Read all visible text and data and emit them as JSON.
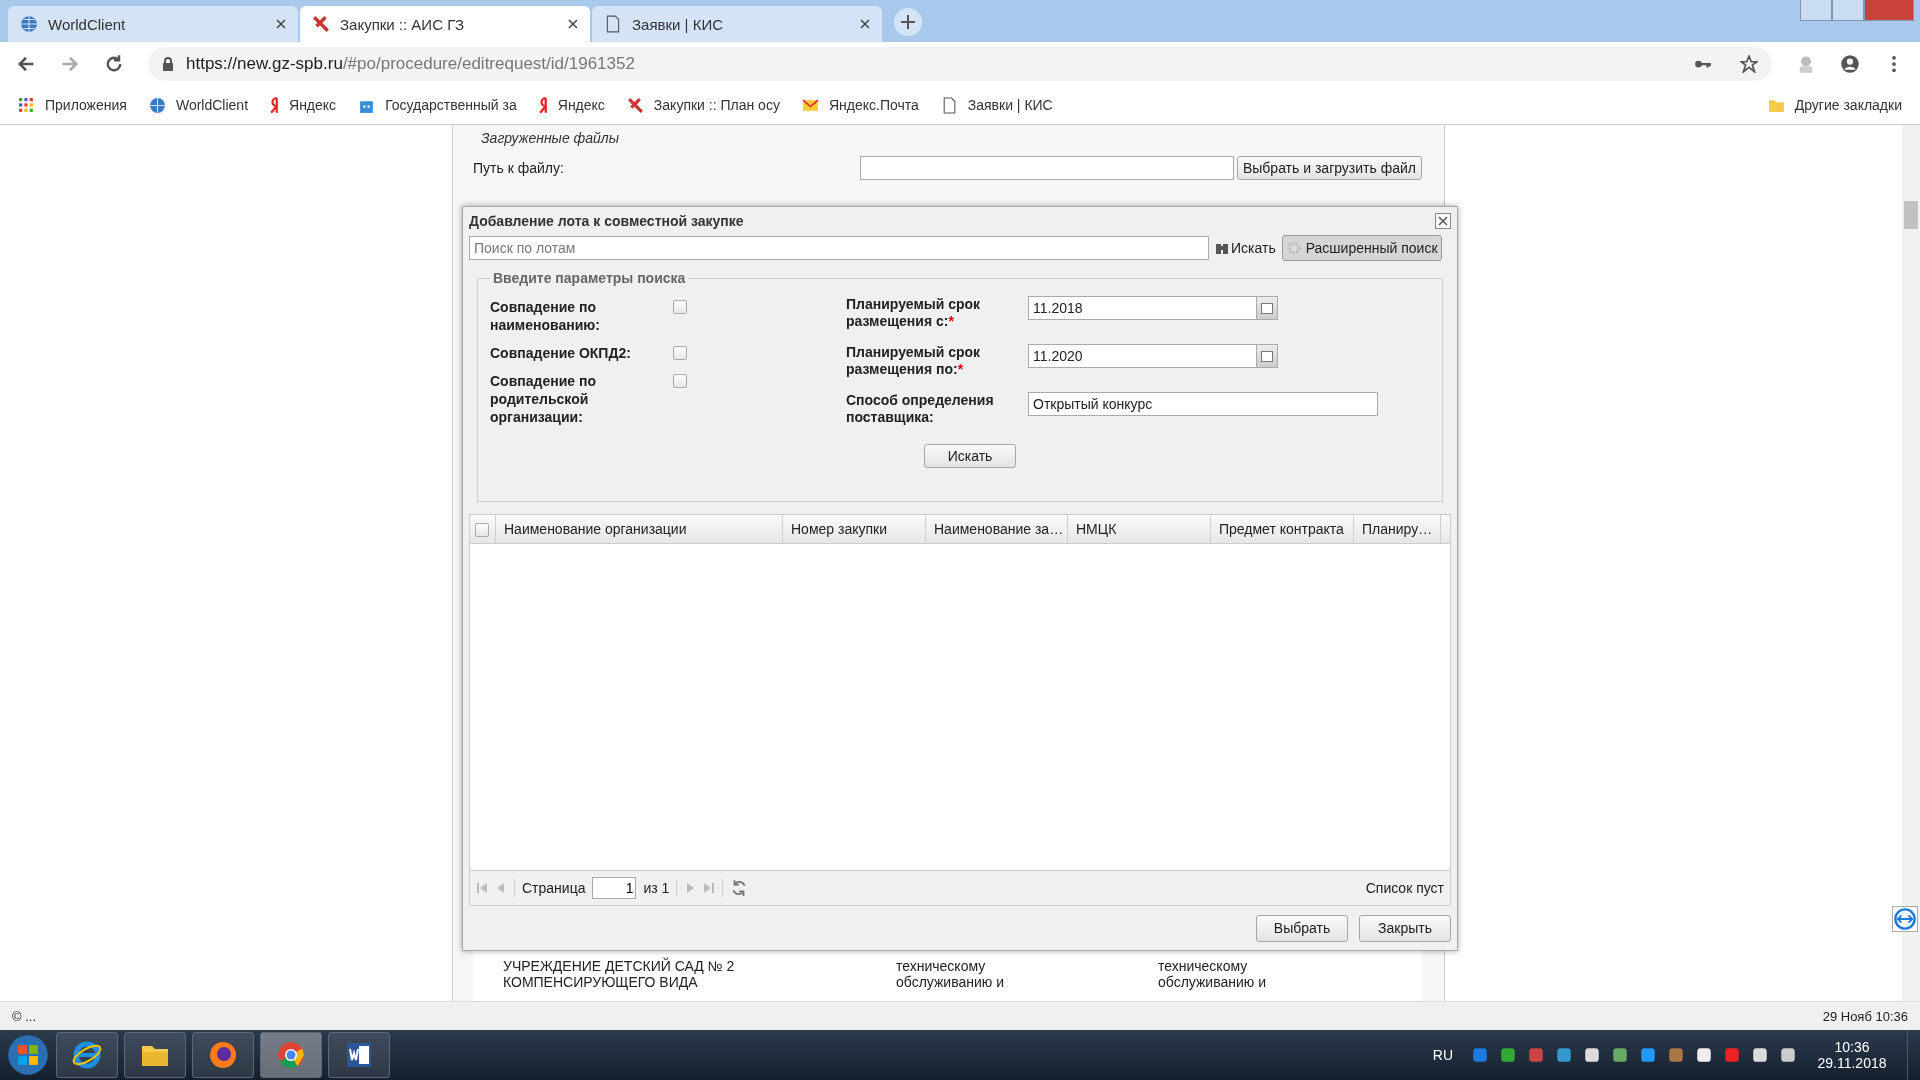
{
  "browser": {
    "tabs": [
      {
        "title": "WorldClient",
        "selected": false
      },
      {
        "title": "Закупки :: АИС ГЗ",
        "selected": true
      },
      {
        "title": "Заявки | КИС",
        "selected": false
      }
    ],
    "url_host": "https://new.gz-spb.ru",
    "url_path": "/#po/procedure/editrequest/id/1961352",
    "bookmarks": [
      {
        "label": "Приложения"
      },
      {
        "label": "WorldClient"
      },
      {
        "label": "Яндекс"
      },
      {
        "label": "Государственный за"
      },
      {
        "label": "Яндекс"
      },
      {
        "label": "Закупки :: План осу"
      },
      {
        "label": "Яндекс.Почта"
      },
      {
        "label": "Заявки | КИС"
      }
    ],
    "other_bookmarks": "Другие закладки"
  },
  "page": {
    "section_title": "Загруженные файлы",
    "file_label": "Путь к файлу:",
    "upload_button": "Выбрать и загрузить файл",
    "background_rows": [
      [
        "УЧРЕЖДЕНИЕ ДЕТСКИЙ САД № 2",
        "техническому",
        "техническому"
      ],
      [
        "КОМПЕНСИРУЮЩЕГО ВИДА",
        "обслуживанию и",
        "обслуживанию и"
      ]
    ]
  },
  "dialog": {
    "title": "Добавление лота к совместной закупке",
    "search": {
      "placeholder": "Поиск по лотам"
    },
    "search_button": "Искать",
    "advanced_button": {
      "label": "Расширенный поиск",
      "selected": true
    },
    "legend": "Введите параметры поиска",
    "checks": [
      {
        "label": "Совпадение по наименованию:",
        "checked": false
      },
      {
        "label": "Совпадение ОКПД2:",
        "checked": false
      },
      {
        "label": "Совпадение по родительской организации:",
        "checked": false
      }
    ],
    "params": [
      {
        "label": "Планируемый срок размещения с:",
        "mark": "*",
        "value": "11.2018",
        "kind": "date"
      },
      {
        "label": "Планируемый срок размещения по:",
        "mark": "*",
        "value": "11.2020",
        "kind": "date"
      },
      {
        "label": "Способ определения поставщика:",
        "value": "Открытый конкурс",
        "kind": "text"
      }
    ],
    "find_button": "Искать",
    "table": {
      "all_checked": false,
      "columns": [
        "Наименование организации",
        "Номер закупки",
        "Наименование за…",
        "НМЦК",
        "Предмет контракта",
        "Планиру…"
      ]
    },
    "pager": {
      "page_label": "Страница",
      "page": "1",
      "of": "из 1",
      "info": "Список пуст"
    },
    "buttons": [
      "Выбрать",
      "Закрыть"
    ]
  },
  "status_bar": {
    "left": "© ...",
    "right": "29 Нояб 10:36"
  },
  "taskbar": {
    "apps": [
      {
        "selected": false
      },
      {
        "selected": false
      },
      {
        "selected": false
      },
      {
        "selected": true
      },
      {
        "selected": false
      }
    ],
    "language": "RU",
    "time": "10:36",
    "date": "29.11.2018"
  }
}
